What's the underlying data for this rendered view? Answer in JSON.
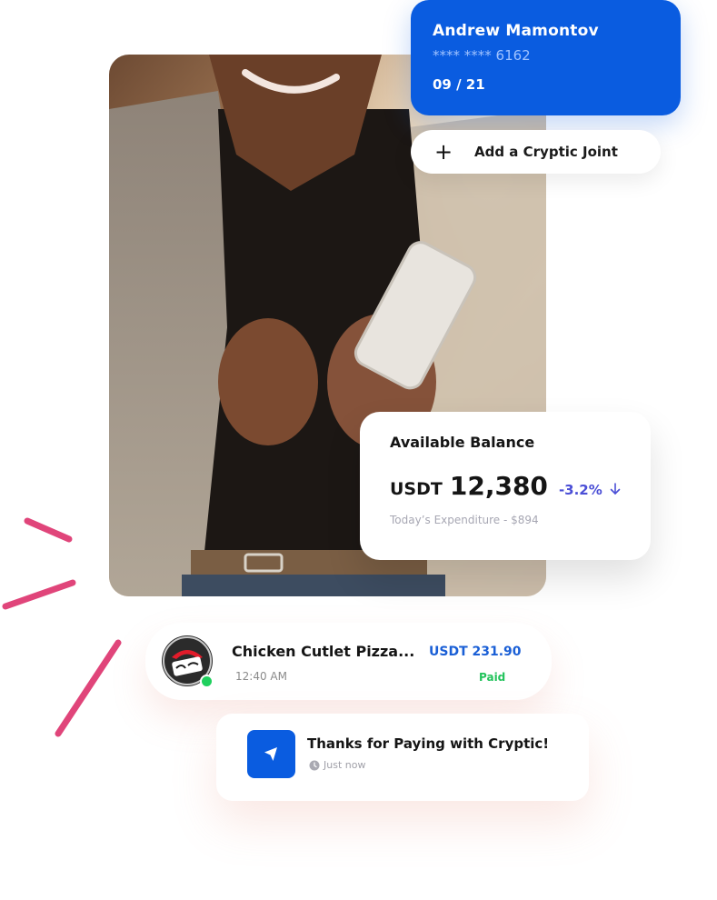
{
  "card": {
    "holder_name": "Andrew Mamontov",
    "number_masked": "**** **** 6162",
    "expiry": "09 / 21"
  },
  "add_joint": {
    "icon": "plus-icon",
    "label": "Add a Cryptic Joint"
  },
  "balance": {
    "title": "Available Balance",
    "currency": "USDT",
    "amount": "12,380",
    "change": "-3.2%",
    "change_icon": "arrow-down-icon",
    "expenditure": "Today’s Expenditure - $894"
  },
  "transaction": {
    "merchant_logo": "pizza-hut-logo",
    "merchant": "Chicken Cutlet Pizza...",
    "time": "12:40 AM",
    "amount": "USDT 231.90",
    "status": "Paid"
  },
  "notification": {
    "icon": "send-arrow-icon",
    "message": "Thanks for Paying with Cryptic!",
    "time_icon": "clock-icon",
    "time": "Just now"
  },
  "colors": {
    "primary": "#0a5ce0",
    "accent_pink": "#e0457a",
    "success": "#23c35c",
    "change_purple": "#4b4fd6"
  }
}
